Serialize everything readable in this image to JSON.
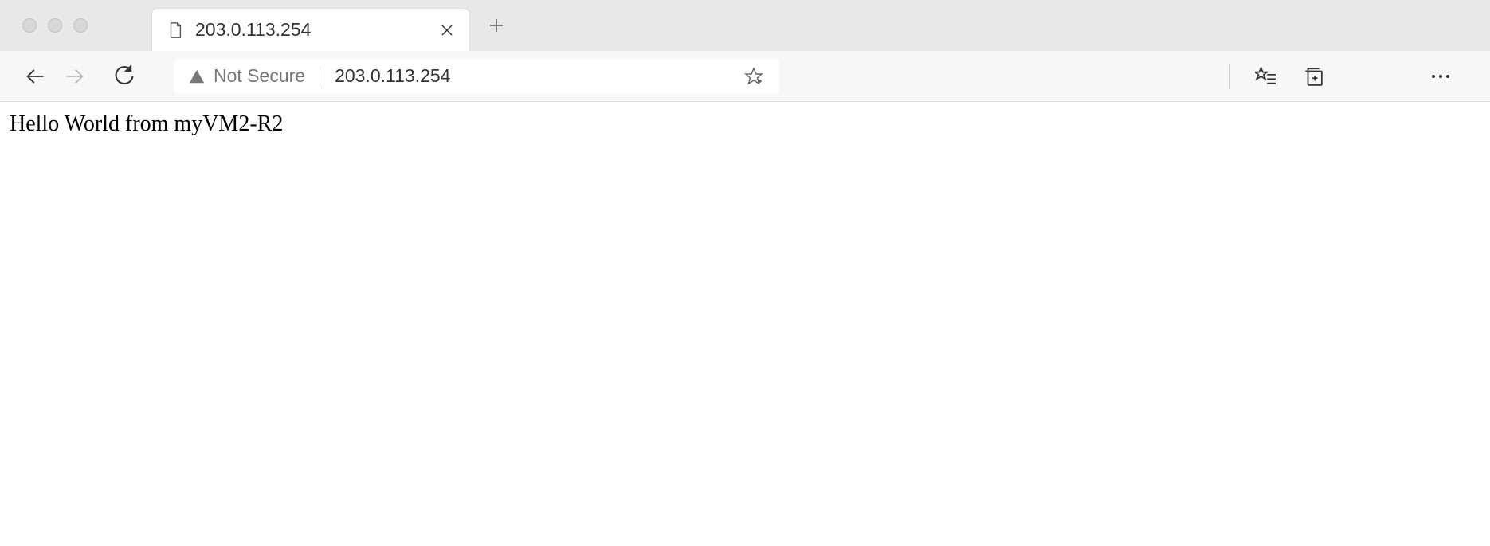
{
  "window": {
    "tab_title": "203.0.113.254"
  },
  "toolbar": {
    "security_label": "Not Secure",
    "url": "203.0.113.254"
  },
  "page": {
    "body_text": "Hello World from myVM2-R2"
  }
}
